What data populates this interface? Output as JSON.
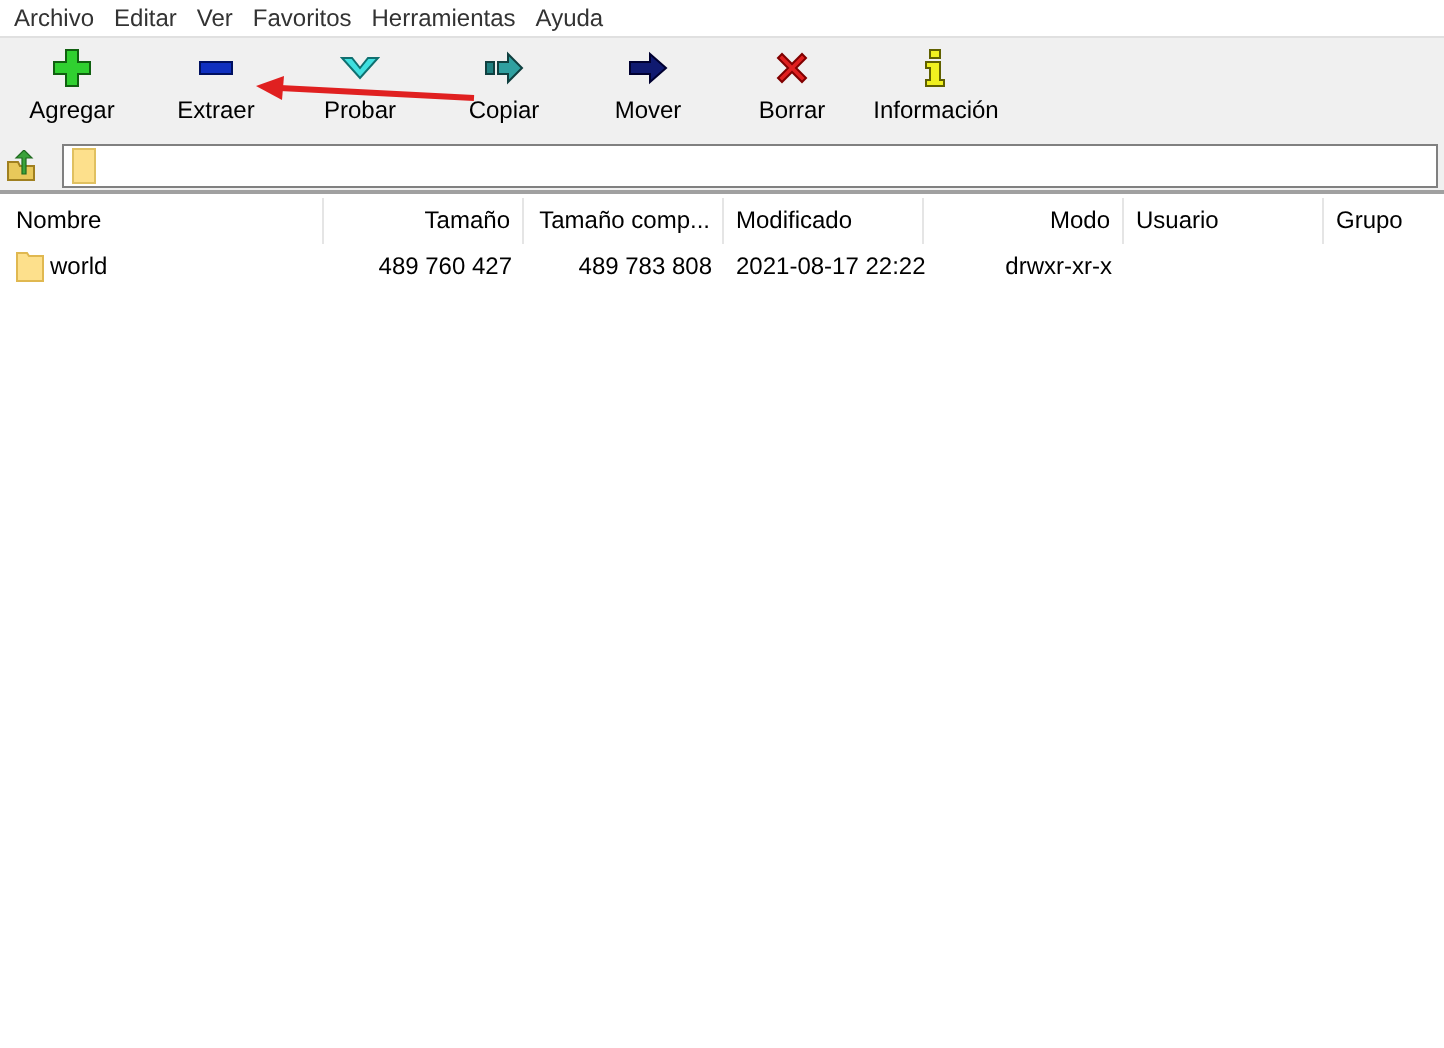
{
  "menu": [
    "Archivo",
    "Editar",
    "Ver",
    "Favoritos",
    "Herramientas",
    "Ayuda"
  ],
  "toolbar": [
    {
      "kind": "add",
      "label": "Agregar"
    },
    {
      "kind": "extract",
      "label": "Extraer"
    },
    {
      "kind": "test",
      "label": "Probar"
    },
    {
      "kind": "copy",
      "label": "Copiar"
    },
    {
      "kind": "move",
      "label": "Mover"
    },
    {
      "kind": "delete",
      "label": "Borrar"
    },
    {
      "kind": "info",
      "label": "Información"
    }
  ],
  "table": {
    "columns": [
      {
        "label": "Nombre"
      },
      {
        "label": "Tamaño"
      },
      {
        "label": "Tamaño comp..."
      },
      {
        "label": "Modificado"
      },
      {
        "label": "Modo"
      },
      {
        "label": "Usuario"
      },
      {
        "label": "Grupo"
      }
    ],
    "rows": [
      {
        "kind": "folder",
        "cells": [
          "world",
          "489 760 427",
          "489 783 808",
          "2021-08-17 22:22",
          "drwxr-xr-x"
        ]
      }
    ]
  },
  "annotation": {
    "kind": "arrow"
  }
}
